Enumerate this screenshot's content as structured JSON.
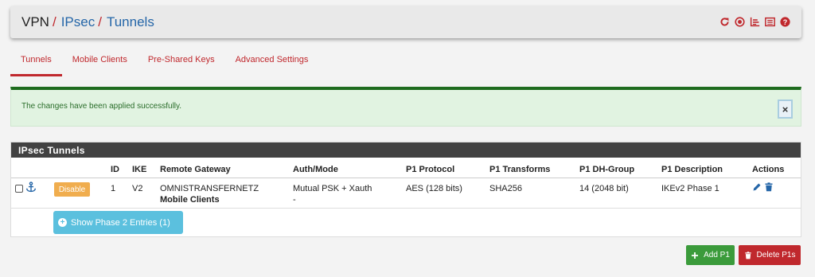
{
  "breadcrumb": {
    "root": "VPN",
    "sep1": "/",
    "level2": "IPsec",
    "sep2": "/",
    "level3": "Tunnels"
  },
  "header_icons": [
    "reload-icon",
    "record-icon",
    "chart-icon",
    "log-icon",
    "help-icon"
  ],
  "tabs": [
    {
      "label": "Tunnels",
      "active": true
    },
    {
      "label": "Mobile Clients",
      "active": false
    },
    {
      "label": "Pre-Shared Keys",
      "active": false
    },
    {
      "label": "Advanced Settings",
      "active": false
    }
  ],
  "alert": {
    "message": "The changes have been applied successfully.",
    "close": "×"
  },
  "panel": {
    "title": "IPsec Tunnels",
    "columns": [
      "ID",
      "IKE",
      "Remote Gateway",
      "Auth/Mode",
      "P1 Protocol",
      "P1 Transforms",
      "P1 DH-Group",
      "P1 Description",
      "Actions"
    ],
    "rows": [
      {
        "disable_label": "Disable",
        "id": "1",
        "ike": "V2",
        "remote_gateway": "OMNISTRANSFERNETZ",
        "remote_gateway_sub": "Mobile Clients",
        "auth_mode": "Mutual PSK + Xauth",
        "auth_mode_sub": "-",
        "p1_protocol": "AES (128 bits)",
        "p1_transforms": "SHA256",
        "p1_dh_group": "14 (2048 bit)",
        "p1_description": "IKEv2 Phase 1"
      }
    ],
    "phase2_button": "Show Phase 2 Entries (1)"
  },
  "buttons": {
    "add": "Add P1",
    "delete": "Delete P1s"
  },
  "colors": {
    "accent": "#c0282d",
    "link": "#2566a8",
    "success": "#3b9b3b",
    "info": "#5bc0de",
    "warning": "#f0ad4e"
  }
}
